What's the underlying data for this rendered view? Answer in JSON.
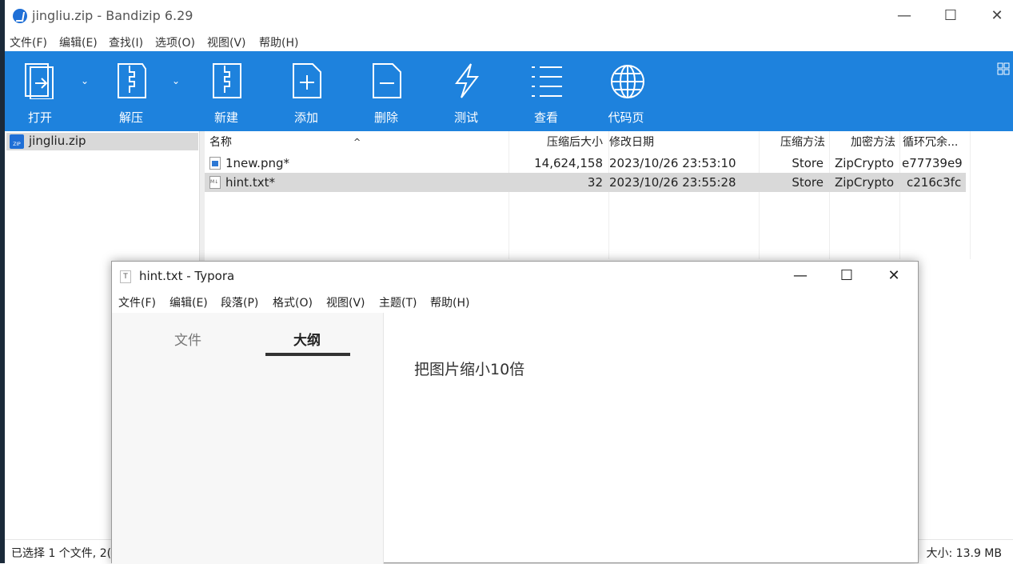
{
  "bandizip": {
    "title": "jingliu.zip - Bandizip 6.29",
    "window_controls": {
      "minimize": "—",
      "maximize": "☐",
      "close": "✕"
    },
    "menu": [
      "文件(F)",
      "编辑(E)",
      "查找(I)",
      "选项(O)",
      "视图(V)",
      "帮助(H)"
    ],
    "toolbar": {
      "open": "打开",
      "extract": "解压",
      "new": "新建",
      "add": "添加",
      "delete": "删除",
      "test": "测试",
      "view": "查看",
      "codepage": "代码页"
    },
    "sidebar": {
      "items": [
        {
          "label": "jingliu.zip"
        }
      ]
    },
    "columns": [
      "名称",
      "压缩后大小",
      "修改日期",
      "压缩方法",
      "加密方法",
      "循环冗余..."
    ],
    "rows": [
      {
        "name": "1new.png*",
        "size": "14,624,158",
        "date": "2023/10/26 23:53:10",
        "method": "Store",
        "encryption": "ZipCrypto",
        "crc": "e77739e9"
      },
      {
        "name": "hint.txt*",
        "size": "32",
        "date": "2023/10/26 23:55:28",
        "method": "Store",
        "encryption": "ZipCrypto",
        "crc": "c216c3fc"
      }
    ],
    "status_left": "已选择 1 个文件, 2(",
    "status_right": "大小: 13.9 MB"
  },
  "typora": {
    "title": "hint.txt - Typora",
    "icon_letter": "T",
    "window_controls": {
      "minimize": "—",
      "maximize": "☐",
      "close": "✕"
    },
    "menu": [
      "文件(F)",
      "编辑(E)",
      "段落(P)",
      "格式(O)",
      "视图(V)",
      "主题(T)",
      "帮助(H)"
    ],
    "tabs": {
      "files": "文件",
      "outline": "大纲"
    },
    "content": "把图片缩小10倍"
  }
}
